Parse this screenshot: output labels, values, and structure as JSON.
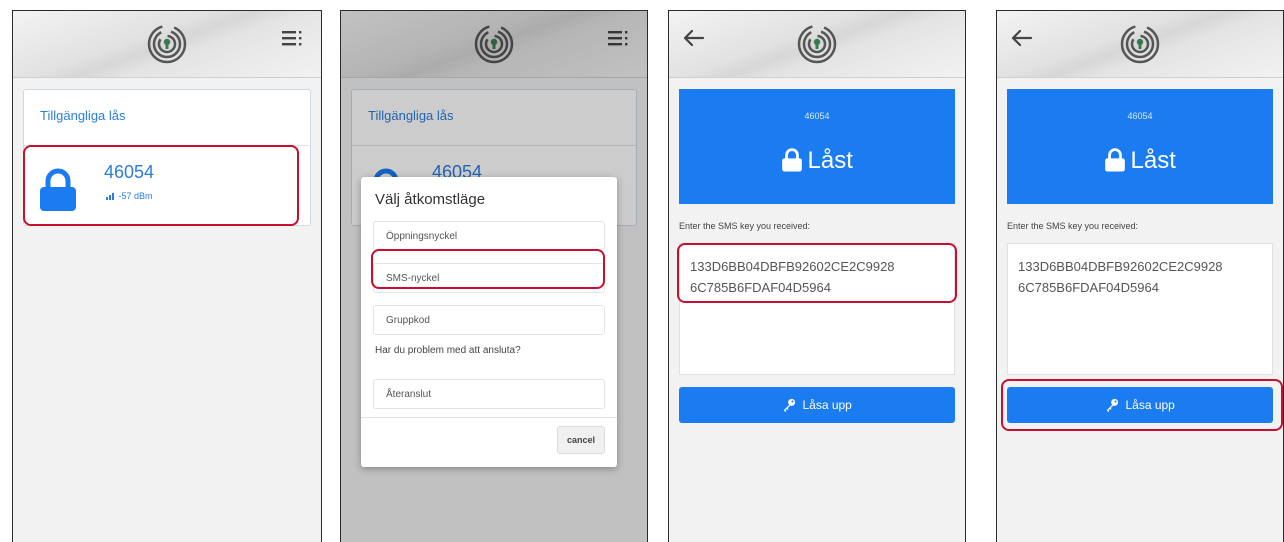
{
  "colors": {
    "primary": "#1a7cf0",
    "link": "#2b7de0",
    "highlight": "#c8102e"
  },
  "screen1": {
    "card_title": "Tillgängliga lås",
    "lock_id": "46054",
    "rssi": "-57 dBm",
    "icons": [
      "logo-icon",
      "menu-icon",
      "padlock-icon"
    ]
  },
  "screen2": {
    "card_title": "Tillgängliga lås",
    "lock_id_partial": "46054",
    "dialog": {
      "title": "Välj åtkomstläge",
      "options": [
        "Öppningsnyckel",
        "SMS-nyckel",
        "Gruppkod"
      ],
      "question": "Har du problem med att ansluta?",
      "reconnect": "Återanslut",
      "cancel": "cancel"
    }
  },
  "screen3": {
    "lock_id": "46054",
    "status": "Låst",
    "sms_label": "Enter the SMS key you received:",
    "sms_line1": "133D6BB04DBFB92602CE2C9928",
    "sms_line2": "6C785B6FDAF04D5964",
    "unlock_label": "Låsa upp"
  },
  "screen4": {
    "lock_id": "46054",
    "status": "Låst",
    "sms_label": "Enter the SMS key you received:",
    "sms_line1": "133D6BB04DBFB92602CE2C9928",
    "sms_line2": "6C785B6FDAF04D5964",
    "unlock_label": "Låsa upp"
  }
}
